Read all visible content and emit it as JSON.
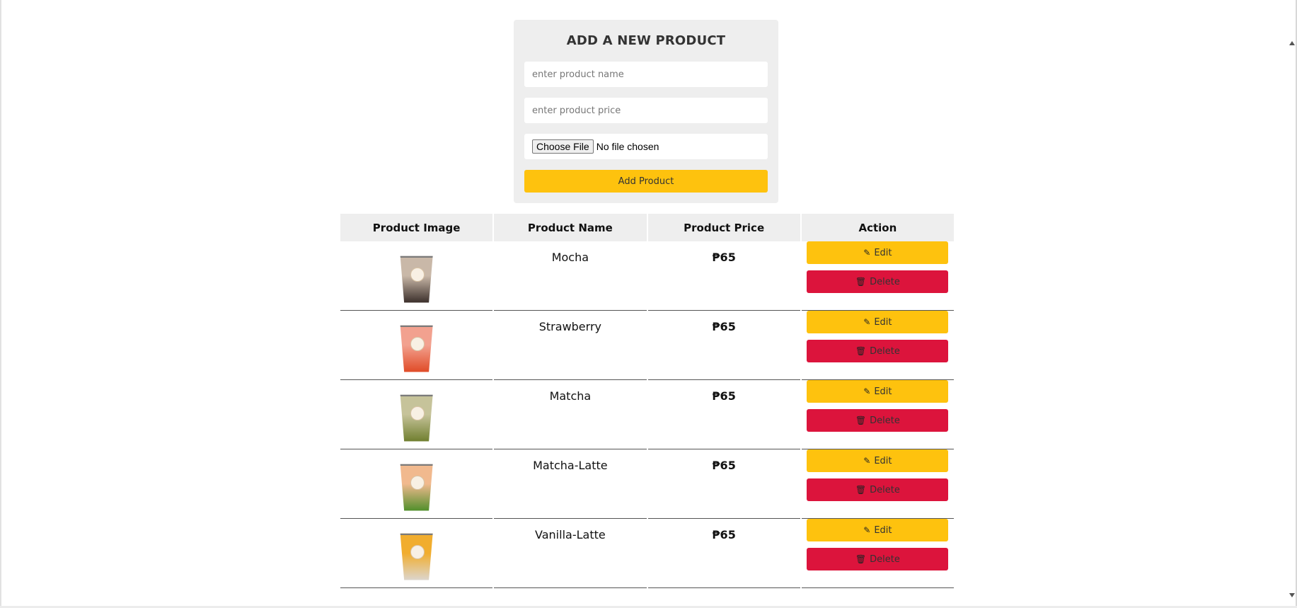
{
  "form": {
    "title": "ADD A NEW PRODUCT",
    "name_placeholder": "enter product name",
    "price_placeholder": "enter product price",
    "file_button_label": "Choose File",
    "file_status": "No file chosen",
    "submit_label": "Add Product"
  },
  "table": {
    "headers": [
      "Product Image",
      "Product Name",
      "Product Price",
      "Action"
    ],
    "edit_label": "Edit",
    "delete_label": "Delete",
    "rows": [
      {
        "name": "Mocha",
        "price": "₱65",
        "cup_top": "#c9b8a8",
        "cup_bottom": "#3a2e2a"
      },
      {
        "name": "Strawberry",
        "price": "₱65",
        "cup_top": "#f2a18f",
        "cup_bottom": "#e04a26"
      },
      {
        "name": "Matcha",
        "price": "₱65",
        "cup_top": "#c6c39a",
        "cup_bottom": "#6f7e2e"
      },
      {
        "name": "Matcha-Latte",
        "price": "₱65",
        "cup_top": "#f1b98e",
        "cup_bottom": "#4f8f2a"
      },
      {
        "name": "Vanilla-Latte",
        "price": "₱65",
        "cup_top": "#f1ad2e",
        "cup_bottom": "#dcd6cf"
      }
    ]
  },
  "icons": {
    "edit": "edit-icon",
    "delete": "trash-icon"
  },
  "colors": {
    "accent_yellow": "#fec20e",
    "delete_red": "#dc143c",
    "card_gray": "#eeeeee"
  }
}
